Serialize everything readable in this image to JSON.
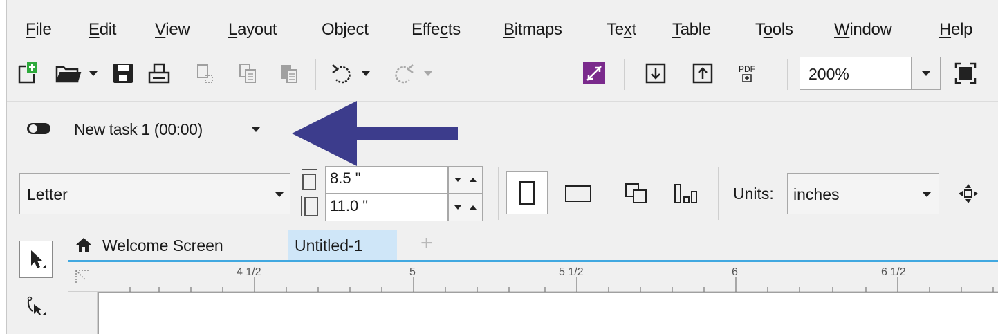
{
  "menu": {
    "items": [
      {
        "label": "File",
        "accel": "F",
        "rest": "ile"
      },
      {
        "label": "Edit",
        "accel": "E",
        "rest": "dit"
      },
      {
        "label": "View",
        "accel": "V",
        "rest": "iew"
      },
      {
        "label": "Layout",
        "accel": "L",
        "rest": "ayout"
      },
      {
        "label": "Object",
        "pre": "Ob",
        "accel": "j",
        "rest": "ect"
      },
      {
        "label": "Effects",
        "pre": "Effe",
        "accel": "c",
        "rest": "ts"
      },
      {
        "label": "Bitmaps",
        "accel": "B",
        "rest": "itmaps"
      },
      {
        "label": "Text",
        "pre": "Te",
        "accel": "x",
        "rest": "t"
      },
      {
        "label": "Table",
        "accel": "T",
        "rest": "able"
      },
      {
        "label": "Tools",
        "pre": "T",
        "accel": "o",
        "rest": "ols"
      },
      {
        "label": "Window",
        "accel": "W",
        "rest": "indow"
      },
      {
        "label": "Help",
        "accel": "H",
        "rest": "elp"
      }
    ]
  },
  "toolbar": {
    "pdf_label": "PDF",
    "zoom_value": "200%"
  },
  "task": {
    "label": "New task 1 (00:00)"
  },
  "property_bar": {
    "page_size": "Letter",
    "width_value": "8.5 \"",
    "height_value": "11.0 \"",
    "units_label": "Units:",
    "units_value": "inches"
  },
  "tabs": {
    "welcome": "Welcome Screen",
    "document": "Untitled-1",
    "add": "+"
  },
  "ruler": {
    "labels": [
      "4 1/2",
      "5",
      "5 1/2",
      "6",
      "6 1/2"
    ]
  },
  "colors": {
    "annotation_arrow": "#3c3c8c",
    "tab_active_bg": "#cfe6f8",
    "tab_underline": "#41a8e0",
    "add_page_plus": "#2eaa3c"
  }
}
